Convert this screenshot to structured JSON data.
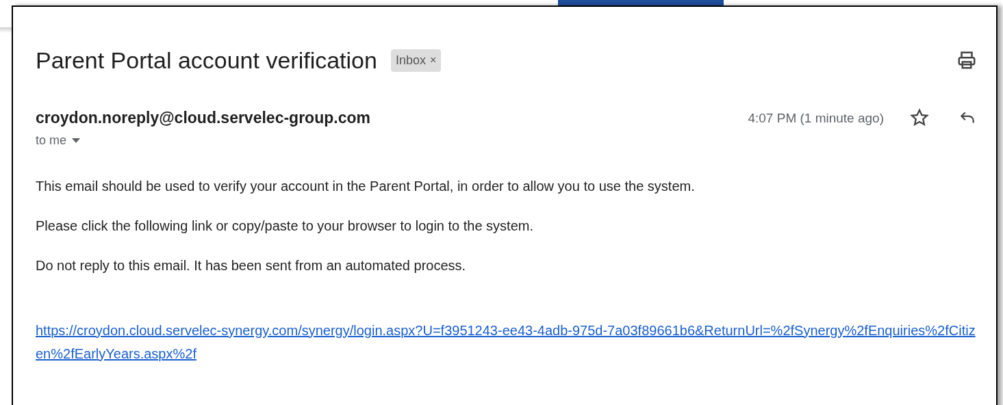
{
  "email": {
    "subject": "Parent Portal account verification",
    "label": {
      "text": "Inbox",
      "remove": "×"
    },
    "sender": "croydon.noreply@cloud.servelec-group.com",
    "recipient": "to me",
    "time": "4:07 PM (1 minute ago)",
    "starred": false,
    "paragraphs": [
      "This email should be used to verify your account in the Parent Portal, in order to allow you to use the system.",
      "Please click the following link or copy/paste to your browser to login to the system.",
      "Do not reply to this email. It has been sent from an automated process."
    ],
    "link": "https://croydon.cloud.servelec-synergy.com/synergy/login.aspx?U=f3951243-ee43-4adb-975d-7a03f89661b6&ReturnUrl=%2fSynergy%2fEnquiries%2fCitizen%2fEarlyYears.aspx%2f"
  }
}
